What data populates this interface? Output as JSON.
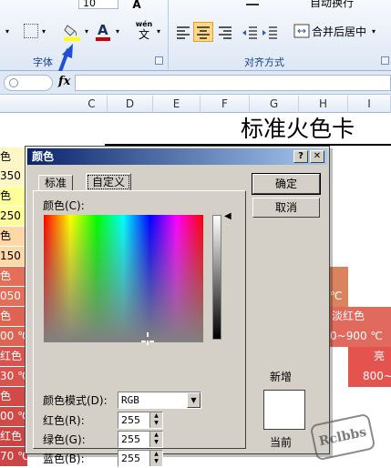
{
  "colors": {
    "accent_red": "#cc0000",
    "highlight_yellow": "#ffff00",
    "arrow_blue": "#1f4fd6",
    "cell_red": "#d9534f",
    "cell_salmon": "#e56e58",
    "cell_orange_brown": "#d9845f",
    "cell_yellow": "#ffff99",
    "cell_peach": "#ffd8a8",
    "cell_light_yellow": "#fff6c8"
  },
  "ribbon": {
    "font_size": "10",
    "group_font": "字体",
    "group_align": "对齐方式",
    "wrap_text": "自动换行",
    "merge_center": "合并后居中",
    "wen": "wén",
    "wen_char": "文",
    "font_color_glyph": "A",
    "fill_icon": "paint-bucket",
    "borders_icon": "borders"
  },
  "formula": {
    "fx": "fx"
  },
  "sheet": {
    "columns": [
      "C",
      "D",
      "E",
      "F",
      "G",
      "H",
      "I"
    ],
    "title": "标准火色卡",
    "left_cells": [
      "色",
      "350",
      "色",
      "250",
      "色",
      "150",
      "色",
      "050 ℃",
      "色",
      "00 ℃",
      "红色",
      "30 ℃",
      "色",
      "00 ℃",
      "红色",
      "70 ℃"
    ],
    "right_cells": [
      "℃",
      "淡红色",
      "0~900 ℃",
      "亮",
      "800~"
    ]
  },
  "dialog": {
    "title": "颜色",
    "help_btn": "?",
    "close_btn": "✕",
    "tab_standard": "标准",
    "tab_custom": "自定义",
    "colors_label": "颜色(C):",
    "ok_button": "确定",
    "cancel_button": "取消",
    "color_mode_label": "颜色模式(D):",
    "color_mode_value": "RGB",
    "red_label": "红色(R):",
    "red_value": "255",
    "green_label": "绿色(G):",
    "green_value": "255",
    "blue_label": "蓝色(B):",
    "blue_value": "255",
    "new_label": "新增",
    "current_label": "当前"
  },
  "watermark": "Rclbbs"
}
